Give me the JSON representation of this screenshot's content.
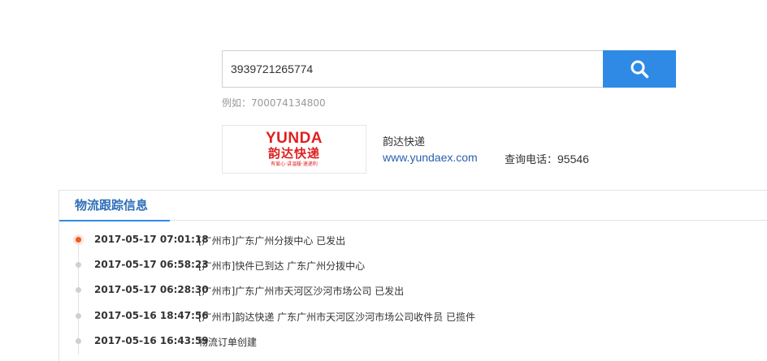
{
  "search": {
    "value": "3939721265774",
    "example": "例如：700074134800"
  },
  "company": {
    "logo_text": "YUNDA",
    "logo_cn": "韵达快递",
    "logo_tagline": "有爱心·讲温暖·速递利",
    "name": "韵达快递",
    "url": "www.yundaex.com",
    "phone_label": "查询电话：",
    "phone_number": "95546"
  },
  "tracking": {
    "title": "物流跟踪信息",
    "events": [
      {
        "time": "2017-05-17 07:01:18",
        "desc": "[广州市]广东广州分拨中心 已发出"
      },
      {
        "time": "2017-05-17 06:58:23",
        "desc": "[广州市]快件已到达 广东广州分拨中心"
      },
      {
        "time": "2017-05-17 06:28:30",
        "desc": "[广州市]广东广州市天河区沙河市场公司 已发出"
      },
      {
        "time": "2017-05-16 18:47:56",
        "desc": "[广州市]韵达快递 广东广州市天河区沙河市场公司收件员 已揽件"
      },
      {
        "time": "2017-05-16 16:43:59",
        "desc": "物流订单创建"
      }
    ]
  },
  "colors": {
    "accent": "#2f8ae6",
    "brand_red": "#e02020",
    "active_dot": "#f05a28"
  }
}
